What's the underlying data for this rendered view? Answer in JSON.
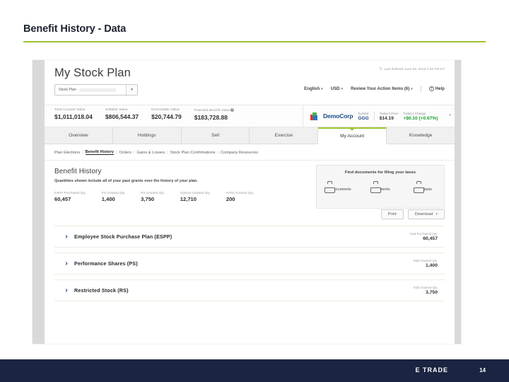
{
  "slide": {
    "title": "Benefit History - Data",
    "page_number": "14",
    "accent_green": "#9ec432",
    "footer_bg": "#1b2440",
    "brand": "E TRADE",
    "brand_star": "*"
  },
  "header": {
    "heading": "My Stock Plan",
    "refresh_icon": "↻",
    "refresh_text": "Last Refresh June 06, 2016 2:02 PM ET",
    "select": {
      "label": "Stock Plan",
      "caret": "▼"
    },
    "links": [
      {
        "label": "English",
        "caret": "▾"
      },
      {
        "label": "USD",
        "caret": "▾"
      },
      {
        "label": "Review Your Action Items (6)",
        "caret": "▾"
      }
    ],
    "help_label": "Help",
    "help_glyph": "?"
  },
  "summary": {
    "metrics": [
      {
        "label": "Total Account Value",
        "value": "$1,011,018.04"
      },
      {
        "label": "Sellable Value",
        "value": "$806,544.37"
      },
      {
        "label": "Exercisable Value",
        "value": "$20,744.79"
      },
      {
        "label": "Potential Benefit Value",
        "value": "$183,728.88",
        "info": "?"
      }
    ],
    "quote": {
      "company": "DemoCorp",
      "symbol_label": "Symbol",
      "symbol": "GGG",
      "price_label": "Today's Price",
      "price": "$14.19",
      "change_label": "Today's Change",
      "change": "+$0.10 (+0.67%)",
      "caret": "▾"
    }
  },
  "tabs": [
    {
      "label": "Overview",
      "active": false
    },
    {
      "label": "Holdings",
      "active": false
    },
    {
      "label": "Sell",
      "active": false
    },
    {
      "label": "Exercise",
      "active": false
    },
    {
      "label": "My Account",
      "active": true
    },
    {
      "label": "Knowledge",
      "active": false
    }
  ],
  "subnav": {
    "separator": "|",
    "items": [
      {
        "label": "Plan Elections",
        "current": false
      },
      {
        "label": "Benefit History",
        "current": true
      },
      {
        "label": "Orders",
        "current": false
      },
      {
        "label": "Gains & Losses",
        "current": false
      },
      {
        "label": "Stock Plan Confirmations",
        "current": false
      },
      {
        "label": "Company Resources",
        "current": false
      }
    ]
  },
  "main": {
    "title": "Benefit History",
    "subtitle": "Quantities shown include all of your past grants over the history of your plan.",
    "quantities": [
      {
        "label": "ESPP Purchased Qty.",
        "value": "60,457"
      },
      {
        "label": "PS Granted Qty.",
        "value": "1,400"
      },
      {
        "label": "RS Granted Qty.",
        "value": "3,750"
      },
      {
        "label": "Options Granted Qty.",
        "value": "12,710"
      },
      {
        "label": "SARs Granted Qty.",
        "value": "200"
      }
    ],
    "tax_panel": {
      "heading": "Find documents for filing your taxes",
      "items": [
        {
          "label": "Tax Documents",
          "icon": "folder-icon"
        },
        {
          "label": "Statements",
          "icon": "folder-icon"
        },
        {
          "label": "Cost Basis",
          "icon": "folder-icon"
        }
      ]
    },
    "actions": {
      "print": "Print",
      "download": "Download",
      "download_caret": "▾"
    },
    "plan_rows": [
      {
        "chevron": "›",
        "name": "Employee Stock Purchase Plan (ESPP)",
        "metric_label": "Total Purchased Qty.",
        "metric_value": "60,457"
      },
      {
        "chevron": "›",
        "name": "Performance Shares (PS)",
        "metric_label": "Total Granted Qty.",
        "metric_value": "1,400"
      },
      {
        "chevron": "›",
        "name": "Restricted Stock (RS)",
        "metric_label": "Total Granted Qty.",
        "metric_value": "3,750"
      }
    ]
  }
}
